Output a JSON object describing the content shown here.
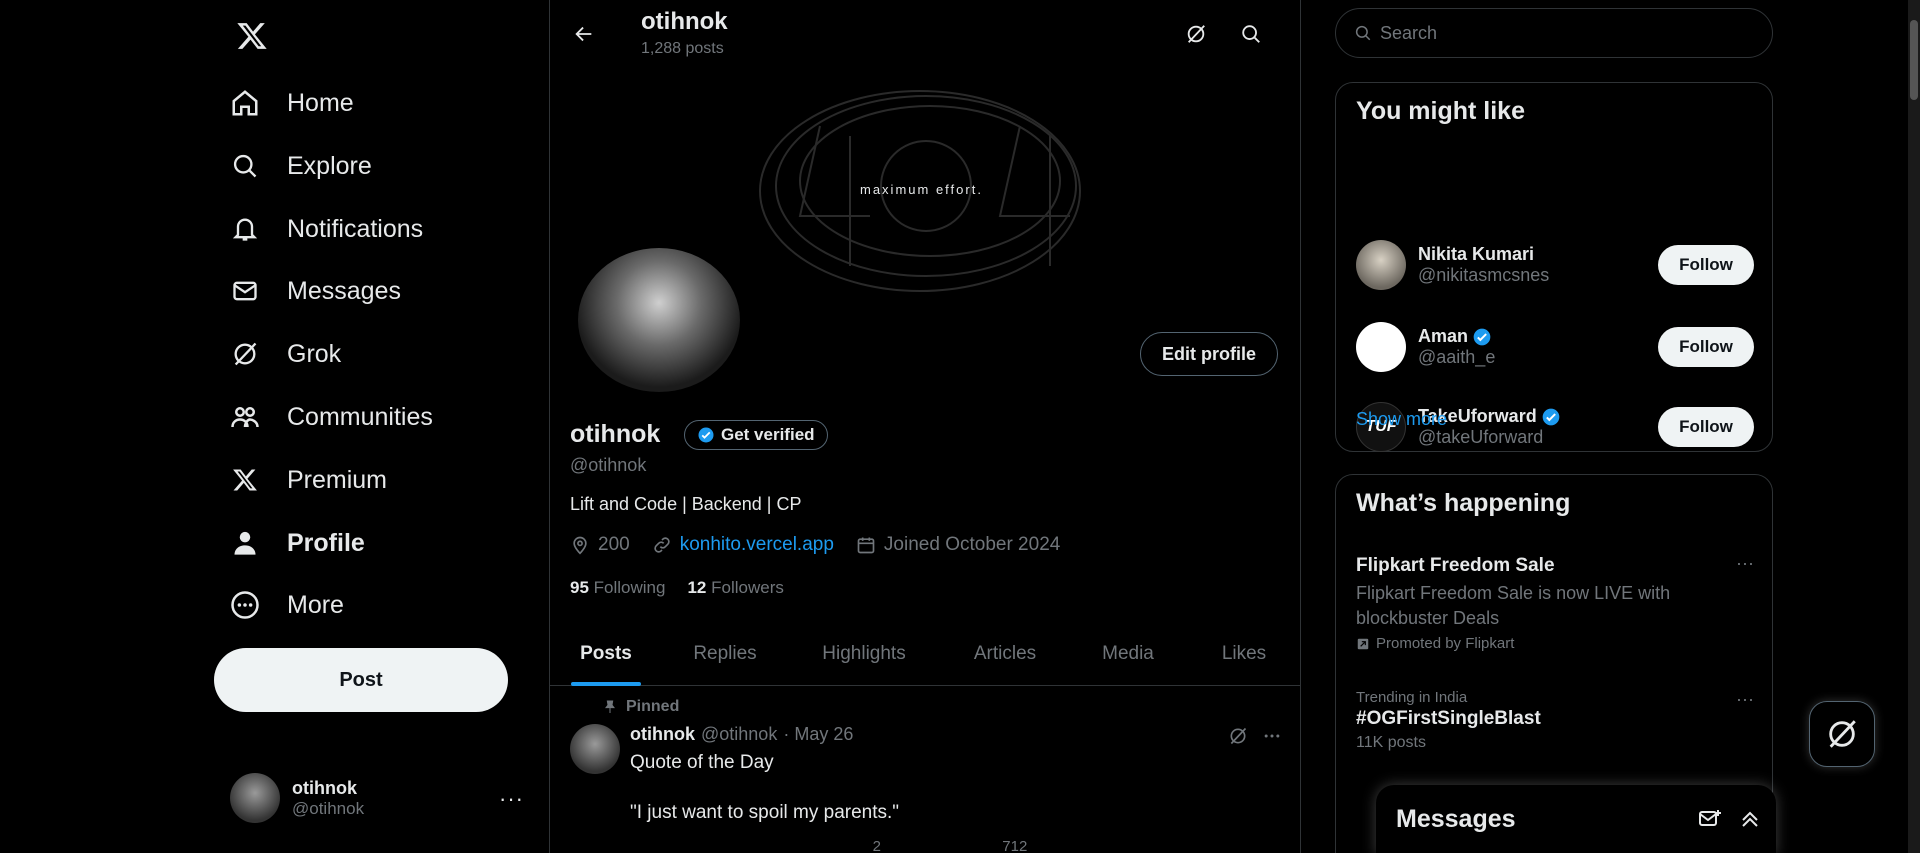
{
  "nav": {
    "logo": "x-logo-icon",
    "items": [
      {
        "label": "Home",
        "icon": "home-icon"
      },
      {
        "label": "Explore",
        "icon": "search-icon"
      },
      {
        "label": "Notifications",
        "icon": "bell-icon"
      },
      {
        "label": "Messages",
        "icon": "mail-icon"
      },
      {
        "label": "Grok",
        "icon": "grok-icon"
      },
      {
        "label": "Communities",
        "icon": "people-icon"
      },
      {
        "label": "Premium",
        "icon": "x-logo-icon"
      },
      {
        "label": "Profile",
        "icon": "person-icon"
      },
      {
        "label": "More",
        "icon": "more-circle-icon"
      }
    ],
    "post_label": "Post",
    "account": {
      "name": "otihnok",
      "handle": "@otihnok",
      "menu": "···"
    }
  },
  "profile": {
    "title": "otihnok",
    "posts_count": "1,288 posts",
    "banner_text": "maximum effort.",
    "edit_label": "Edit profile",
    "display_name": "otihnok",
    "get_verified": "Get verified",
    "handle": "@otihnok",
    "bio": "Lift and Code | Backend | CP",
    "location": "200",
    "link": "konhito.vercel.app",
    "joined": "Joined October 2024",
    "following_count": "95",
    "following_label": "Following",
    "followers_count": "12",
    "followers_label": "Followers"
  },
  "tabs": [
    "Posts",
    "Replies",
    "Highlights",
    "Articles",
    "Media",
    "Likes"
  ],
  "post": {
    "pinned": "Pinned",
    "name": "otihnok",
    "handle": "@otihnok",
    "date": "· May 26",
    "text1": "Quote of the Day",
    "text2": "\"I just want to spoil my parents.\"",
    "actions": [
      "",
      "",
      "2",
      "712",
      "",
      ""
    ]
  },
  "right": {
    "search_placeholder": "Search",
    "wtf_title": "You might like",
    "suggestions": [
      {
        "name": "Nikita Kumari",
        "handle": "@nikitasmcsnes",
        "verified": false,
        "follow": "Follow"
      },
      {
        "name": "Aman",
        "handle": "@aaith_e",
        "verified": true,
        "follow": "Follow"
      },
      {
        "name": "TakeUforward",
        "handle": "@takeUforward",
        "verified": true,
        "follow": "Follow"
      }
    ],
    "show_more": "Show more",
    "happening_title": "What’s happening",
    "trends": [
      {
        "title": "Flipkart Freedom Sale",
        "desc": "Flipkart Freedom Sale is now LIVE with blockbuster Deals",
        "promo": "Promoted by Flipkart"
      },
      {
        "context": "Trending in India",
        "title": "#OGFirstSingleBlast",
        "count": "11K posts"
      }
    ]
  },
  "messages_drawer": {
    "title": "Messages"
  },
  "colors": {
    "accent": "#1d9bf0",
    "bg": "#000000",
    "text": "#e7e9ea",
    "muted": "#71767b"
  }
}
